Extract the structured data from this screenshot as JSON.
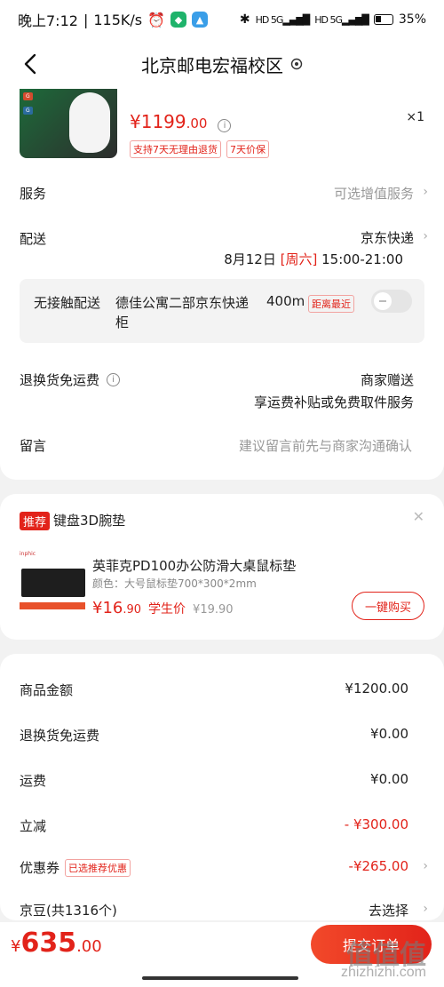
{
  "status": {
    "time": "晚上7:12",
    "net_speed": "115K/s",
    "network": "5G",
    "battery": "35%",
    "battery_level": 0.35
  },
  "nav": {
    "title": "北京邮电宏福校区"
  },
  "product": {
    "price_int": "¥1199",
    "price_dec": ".00",
    "qty": "×1",
    "tags": [
      "支持7天无理由退货",
      "7天价保"
    ]
  },
  "service": {
    "label": "服务",
    "value": "可选增值服务"
  },
  "delivery": {
    "label": "配送",
    "carrier": "京东快递",
    "date": "8月12日",
    "weekday": "[周六]",
    "time_window": "15:00-21:00"
  },
  "contactless": {
    "label": "无接触配送",
    "location": "德佳公寓二部京东快递柜",
    "distance": "400m",
    "badge": "距离最近"
  },
  "return_fee": {
    "label": "退换货免运费",
    "value1": "商家赠送",
    "value2": "享运费补贴或免费取件服务"
  },
  "message": {
    "label": "留言",
    "placeholder": "建议留言前先与商家沟通确认"
  },
  "recommend": {
    "badge": "推荐",
    "title": "键盘3D腕垫",
    "name": "英菲克PD100办公防滑大桌鼠标垫",
    "spec": "颜色：大号鼠标垫700*300*2mm",
    "price_int": "¥16",
    "price_dec": ".90",
    "student": "学生价",
    "orig": "¥19.90",
    "buy": "一键购买"
  },
  "summary": {
    "rows": [
      {
        "label": "商品金额",
        "value": "¥1200.00"
      },
      {
        "label": "退换货免运费",
        "value": "¥0.00"
      },
      {
        "label": "运费",
        "value": "¥0.00"
      },
      {
        "label": "立减",
        "value": "- ¥300.00"
      },
      {
        "label": "优惠券",
        "badge": "已选推荐优惠",
        "value": "-¥265.00"
      },
      {
        "label": "京豆(共1316个)",
        "value": "去选择"
      }
    ]
  },
  "footer": {
    "sym": "¥",
    "total_int": "635",
    "total_dec": ".00",
    "submit": "提交订单"
  },
  "watermark": {
    "text": "值值值",
    "url": "zhizhizhi.com"
  }
}
